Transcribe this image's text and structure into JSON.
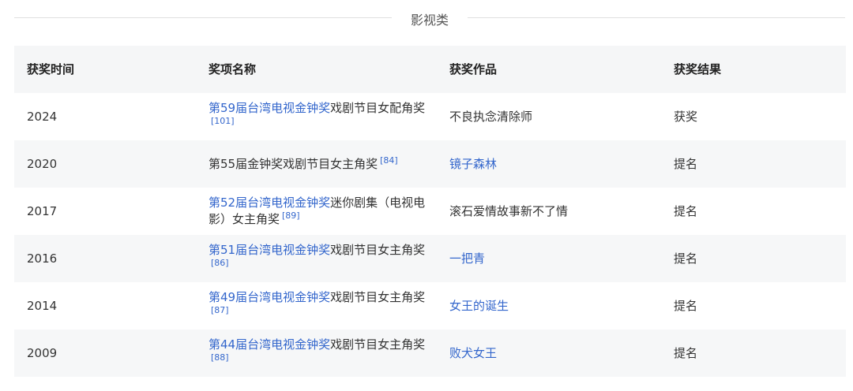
{
  "section": {
    "title": "影视类"
  },
  "table": {
    "headers": [
      "获奖时间",
      "奖项名称",
      "获奖作品",
      "获奖结果"
    ],
    "rows": [
      {
        "year": "2024",
        "award_link": "第59届台湾电视金钟奖",
        "award_text": "戏剧节目女配角奖",
        "ref": "[101]",
        "work": "不良执念清除师",
        "work_is_link": false,
        "result": "获奖"
      },
      {
        "year": "2020",
        "award_link": "",
        "award_text": "第55届金钟奖戏剧节目女主角奖",
        "ref": "[84]",
        "work": "镜子森林",
        "work_is_link": true,
        "result": "提名"
      },
      {
        "year": "2017",
        "award_link": "第52届台湾电视金钟奖",
        "award_text": "迷你剧集（电视电影）女主角奖",
        "ref": "[89]",
        "work": "滚石爱情故事新不了情",
        "work_is_link": false,
        "result": "提名"
      },
      {
        "year": "2016",
        "award_link": "第51届台湾电视金钟奖",
        "award_text": "戏剧节目女主角奖",
        "ref": "[86]",
        "work": "一把青",
        "work_is_link": true,
        "result": "提名"
      },
      {
        "year": "2014",
        "award_link": "第49届台湾电视金钟奖",
        "award_text": "戏剧节目女主角奖",
        "ref": "[87]",
        "work": "女王的诞生",
        "work_is_link": true,
        "result": "提名"
      },
      {
        "year": "2009",
        "award_link": "第44届台湾电视金钟奖",
        "award_text": "戏剧节目女主角奖",
        "ref": "[88]",
        "work": "败犬女王",
        "work_is_link": true,
        "result": "提名"
      }
    ]
  }
}
